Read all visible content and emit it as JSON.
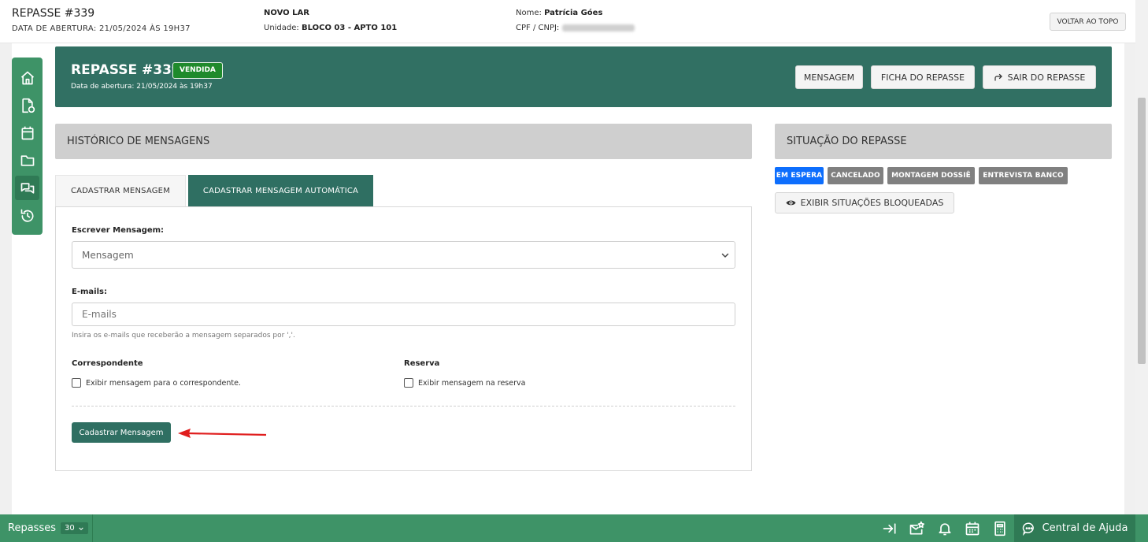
{
  "topbar": {
    "title": "REPASSE #339",
    "opening": "DATA DE ABERTURA: 21/05/2024 ÀS 19H37",
    "project": "NOVO LAR",
    "unit_label": "Unidade:",
    "unit_value": "BLOCO 03 - APTO 101",
    "name_label": "Nome:",
    "name_value": "Patrícia Góes",
    "cpf_label": "CPF / CNPJ:",
    "back_to_top": "VOLTAR AO TOPO"
  },
  "sidenav": {
    "items": [
      "home-icon",
      "document-icon",
      "calendar-icon",
      "folder-icon",
      "chat-icon",
      "history-icon"
    ],
    "active": "chat-icon"
  },
  "header": {
    "title": "REPASSE #339",
    "status_badge": "VENDIDA",
    "date": "Data de abertura: 21/05/2024 às 19h37",
    "btn_message": "MENSAGEM",
    "btn_sheet": "FICHA DO REPASSE",
    "btn_exit": "SAIR DO REPASSE"
  },
  "history": {
    "title": "HISTÓRICO DE MENSAGENS",
    "tabs": [
      {
        "label": "CADASTRAR MENSAGEM",
        "active": false
      },
      {
        "label": "CADASTRAR MENSAGEM AUTOMÁTICA",
        "active": true
      }
    ],
    "form": {
      "message_label": "Escrever Mensagem:",
      "message_select": "Mensagem",
      "emails_label": "E-mails:",
      "emails_placeholder": "E-mails",
      "emails_hint": "Insira os e-mails que receberão a mensagem separados por ','.",
      "correspondente_label": "Correspondente",
      "correspondente_checkbox": "Exibir mensagem para o correspondente.",
      "reserva_label": "Reserva",
      "reserva_checkbox": "Exibir mensagem na reserva",
      "submit": "Cadastrar Mensagem"
    }
  },
  "situacao": {
    "title": "SITUAÇÃO DO REPASSE",
    "badges": [
      {
        "label": "EM ESPERA",
        "color": "#0d6efd"
      },
      {
        "label": "CANCELADO",
        "color": "#808080"
      },
      {
        "label": "MONTAGEM DOSSIÊ",
        "color": "#808080"
      },
      {
        "label": "ENTREVISTA BANCO",
        "color": "#808080"
      }
    ],
    "show_blocked": "EXIBIR SITUAÇÕES BLOQUEADAS"
  },
  "bottombar": {
    "label": "Repasses",
    "count": "30",
    "help": "Central de Ajuda"
  },
  "colors": {
    "primary": "#317063",
    "bar": "#3e9367",
    "accent_blue": "#0d6efd",
    "arrow": "#e01e1e"
  }
}
